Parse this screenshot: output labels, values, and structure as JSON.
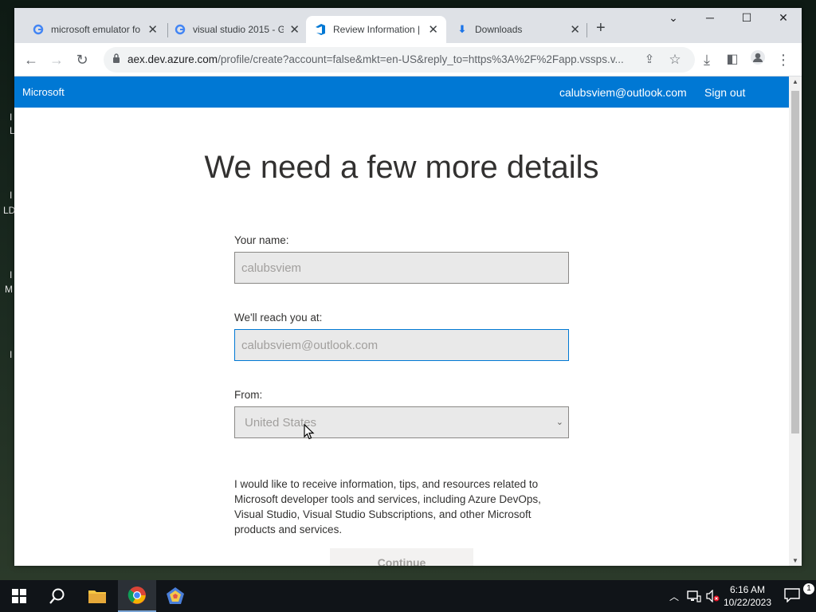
{
  "browser": {
    "tabs": [
      {
        "title": "microsoft emulator fo",
        "favicon": "google-g"
      },
      {
        "title": "visual studio 2015 - G",
        "favicon": "google-g"
      },
      {
        "title": "Review Information |",
        "favicon": "azure-devops"
      },
      {
        "title": "Downloads",
        "favicon": "download"
      }
    ],
    "address": {
      "host": "aex.dev.azure.com",
      "path": "/profile/create?account=false&mkt=en-US&reply_to=https%3A%2F%2Fapp.vssps.v..."
    }
  },
  "header": {
    "brand": "Microsoft",
    "email": "calubsviem@outlook.com",
    "sign_out": "Sign out"
  },
  "form": {
    "heading": "We need a few more details",
    "name_label": "Your name:",
    "name_value": "calubsviem",
    "email_label": "We'll reach you at:",
    "email_value": "calubsviem@outlook.com",
    "country_label": "From:",
    "country_value": "United States",
    "consent_text": "I would like to receive information, tips, and resources related to Microsoft developer tools and services, including Azure DevOps, Visual Studio, Visual Studio Subscriptions, and other Microsoft products and services.",
    "continue_label": "Continue"
  },
  "taskbar": {
    "time": "6:16 AM",
    "date": "10/22/2023",
    "notifications": "1"
  },
  "colors": {
    "accent": "#0078d4",
    "taskbar": "#101418"
  }
}
